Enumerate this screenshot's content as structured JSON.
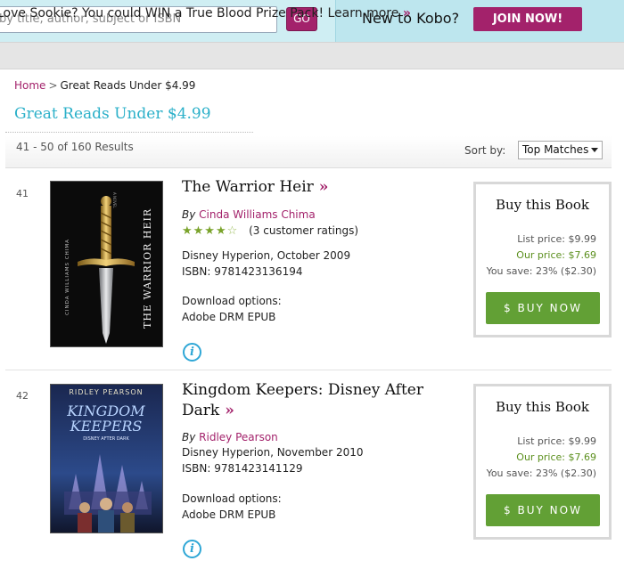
{
  "header": {
    "search_placeholder": "by title, author, subject or ISBN",
    "go_label": "GO",
    "new_to_kobo": "New to Kobo?",
    "join_label": "JOIN NOW!"
  },
  "promo": {
    "text": "Love Sookie? You could WIN a True Blood Prize Pack! Learn more",
    "arrow": "»"
  },
  "breadcrumb": {
    "home": "Home",
    "separator": ">",
    "current": "Great Reads Under $4.99"
  },
  "page_title": "Great Reads Under $4.99",
  "results": {
    "count_text": "41 - 50 of 160 Results",
    "sort_label": "Sort by:",
    "sort_value": "Top Matches"
  },
  "books": [
    {
      "rank": "41",
      "title": "The Warrior Heir",
      "arrow": "»",
      "by": "By",
      "author": "Cinda Williams Chima",
      "rating_stars": 4,
      "rating_text": "(3 customer ratings)",
      "publisher_date": "Disney Hyperion, October 2009",
      "isbn": "ISBN: 9781423136194",
      "download_label": "Download options:",
      "download_format": "Adobe DRM EPUB",
      "cover_text_vertical": "THE WARRIOR HEIR",
      "cover_author_vertical": "CINDA WILLIAMS CHIMA",
      "cover_top_text": "A NOVEL",
      "buy": {
        "title": "Buy this Book",
        "list_price": "List price: $9.99",
        "our_price": "Our price: $7.69",
        "you_save": "You save: 23% ($2.30)",
        "button": "$ BUY NOW"
      }
    },
    {
      "rank": "42",
      "title_line1": "Kingdom Keepers: Disney After",
      "title_line2": "Dark",
      "arrow": "»",
      "by": "By",
      "author": "Ridley Pearson",
      "publisher_date": "Disney Hyperion, November 2010",
      "isbn": "ISBN: 9781423141129",
      "download_label": "Download options:",
      "download_format": "Adobe DRM EPUB",
      "cover_author": "RIDLEY PEARSON",
      "cover_title1": "KINGDOM",
      "cover_title2": "KEEPERS",
      "cover_subtitle": "DISNEY AFTER DARK",
      "buy": {
        "title": "Buy this Book",
        "list_price": "List price: $9.99",
        "our_price": "Our price: $7.69",
        "you_save": "You save: 23% ($2.30)",
        "button": "$ BUY NOW"
      }
    }
  ],
  "colors": {
    "brand_magenta": "#a3226b",
    "title_teal": "#2bb0c9",
    "buy_green": "#62a035"
  }
}
